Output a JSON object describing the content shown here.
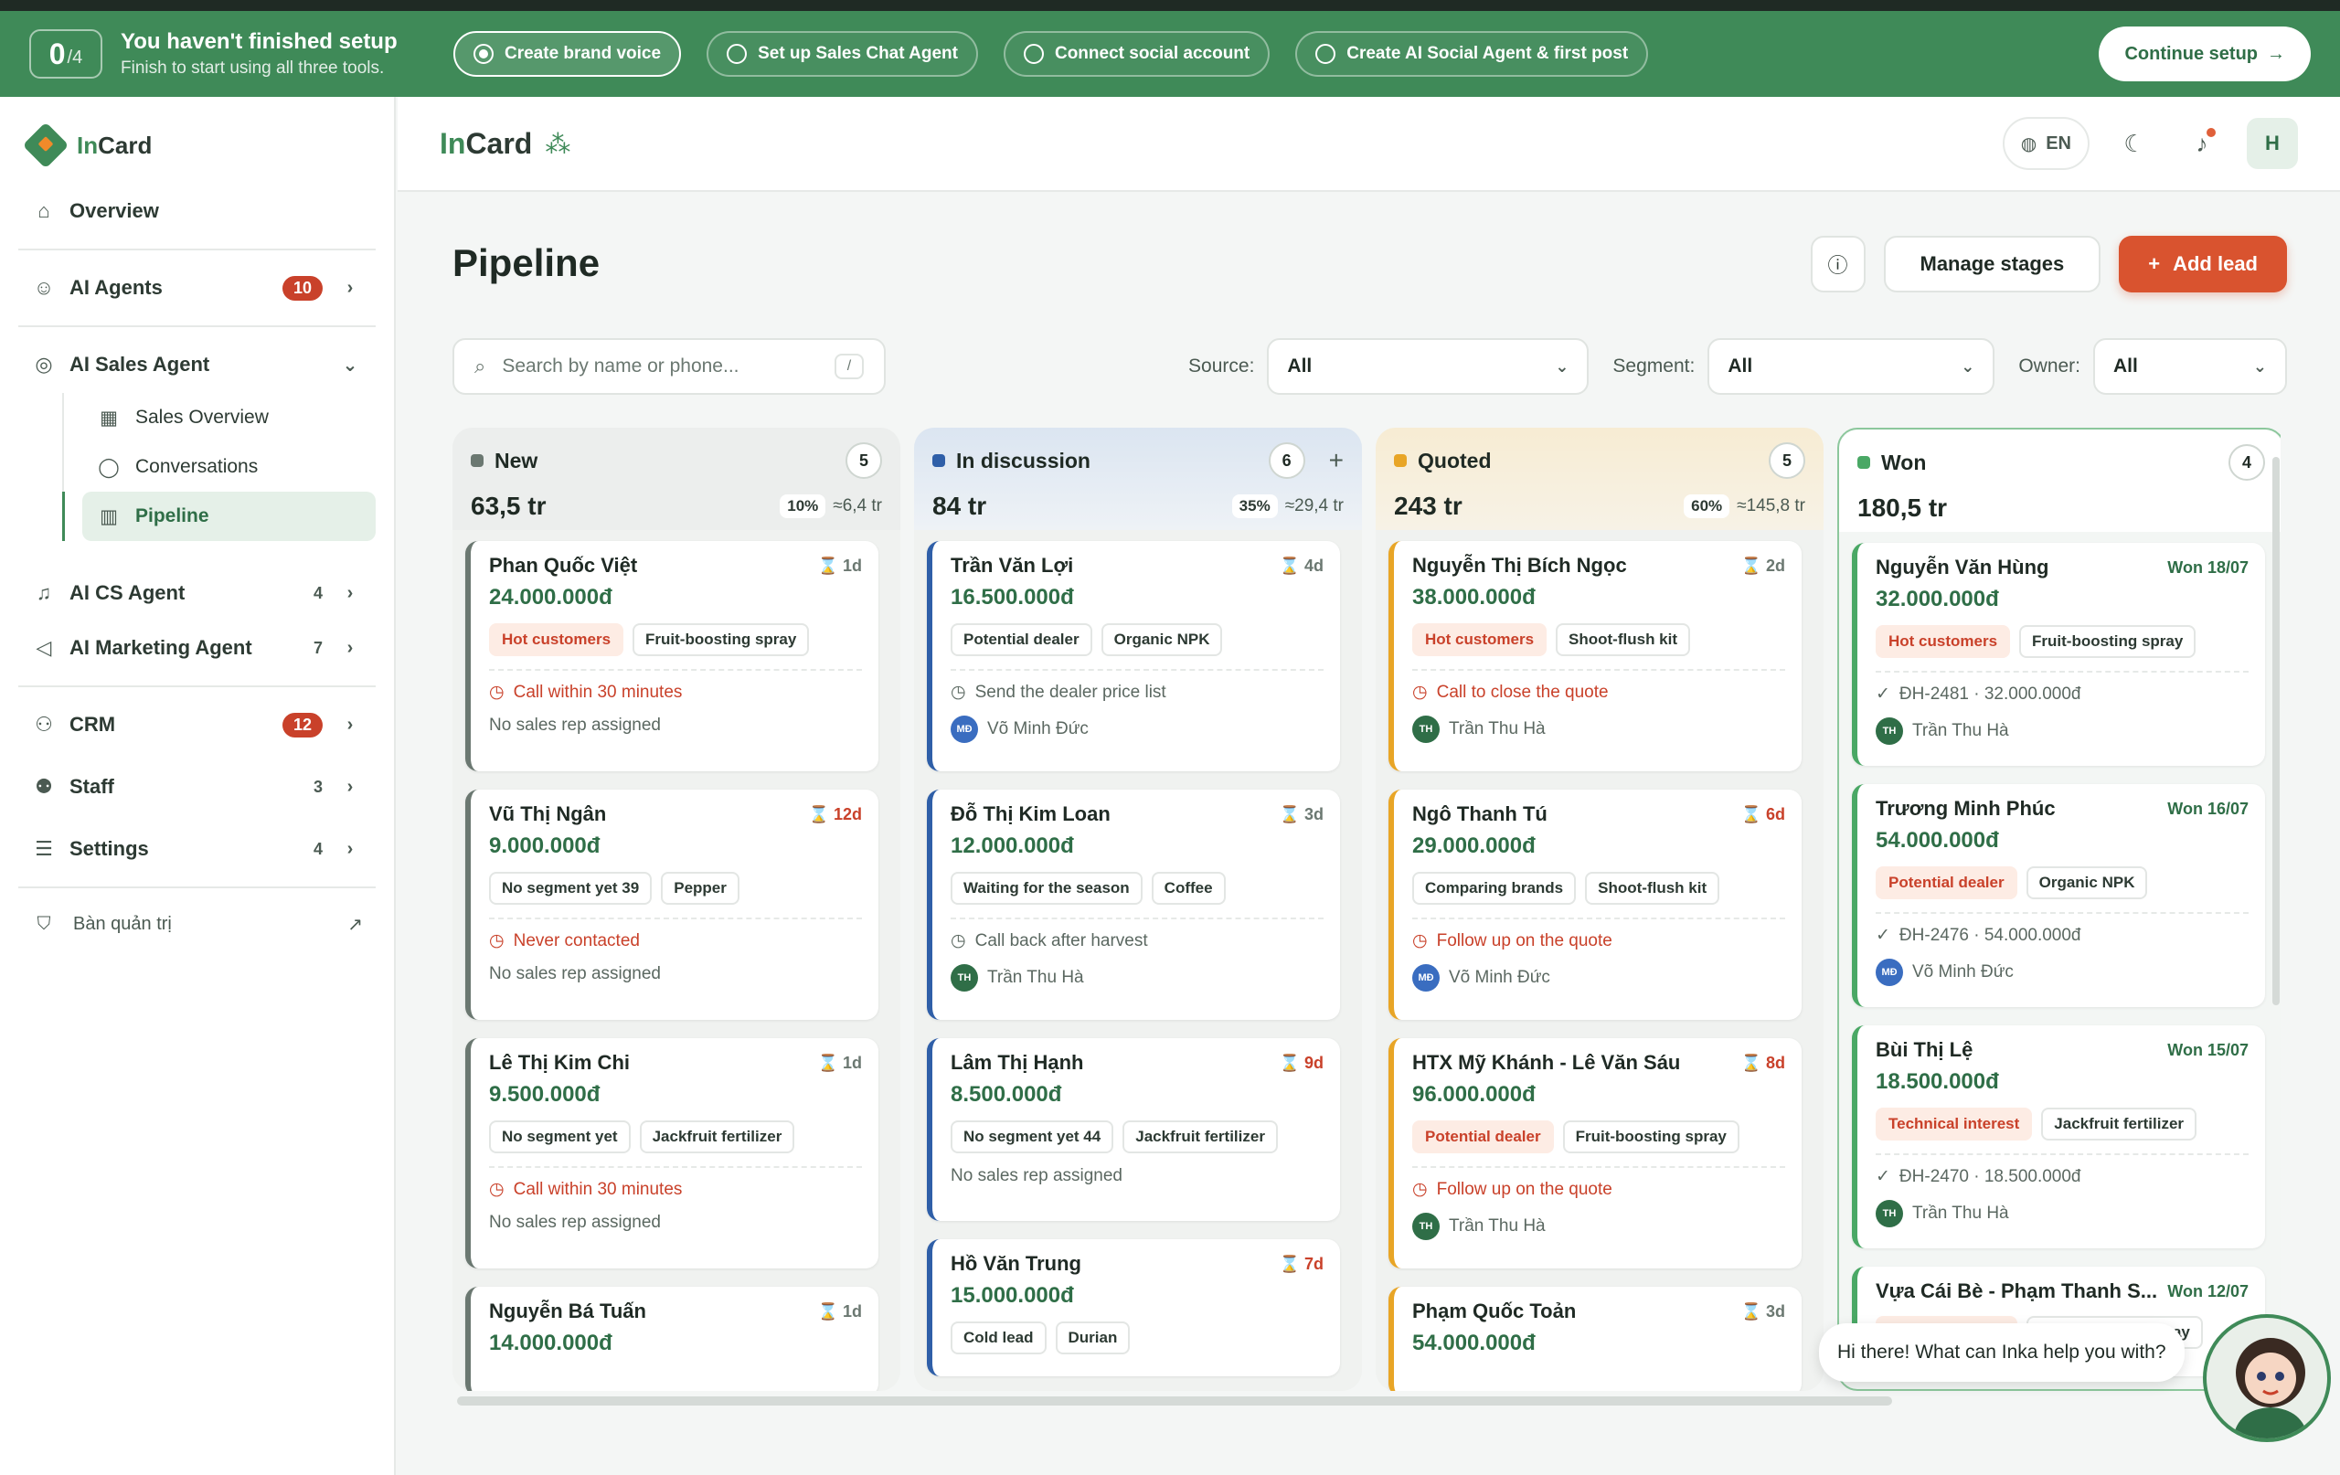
{
  "setup": {
    "progress_main": "0",
    "progress_total": "/4",
    "title": "You haven't finished setup",
    "subtitle": "Finish to start using all three tools.",
    "steps": [
      {
        "label": "Create brand voice"
      },
      {
        "label": "Set up Sales Chat Agent"
      },
      {
        "label": "Connect social account"
      },
      {
        "label": "Create AI Social Agent & first post"
      }
    ],
    "continue_label": "Continue setup",
    "continue_arrow": "→"
  },
  "sidebar": {
    "logo_prefix": "In",
    "logo_suffix": "Card",
    "overview": "Overview",
    "ai_agents": {
      "label": "AI Agents",
      "badge": "10"
    },
    "ai_sales_agent": {
      "label": "AI Sales Agent"
    },
    "sub_items": [
      {
        "label": "Sales Overview"
      },
      {
        "label": "Conversations"
      },
      {
        "label": "Pipeline"
      }
    ],
    "ai_cs_agent": {
      "label": "AI CS Agent",
      "count": "4"
    },
    "ai_marketing_agent": {
      "label": "AI Marketing Agent",
      "count": "7"
    },
    "crm": {
      "label": "CRM",
      "badge": "12"
    },
    "staff": {
      "label": "Staff",
      "count": "3"
    },
    "settings": {
      "label": "Settings",
      "count": "4"
    },
    "admin": "Bàn quản trị"
  },
  "header": {
    "brand_prefix": "In",
    "brand_suffix": "Card",
    "lang": "EN",
    "avatar": "H"
  },
  "page": {
    "title": "Pipeline",
    "manage_label": "Manage stages",
    "add_label": "Add lead",
    "add_icon": "+",
    "search_placeholder": "Search by name or phone...",
    "search_kbd": "/",
    "filters": [
      {
        "label": "Source:",
        "value": "All"
      },
      {
        "label": "Segment:",
        "value": "All"
      },
      {
        "label": "Owner:",
        "value": "All"
      }
    ]
  },
  "columns": [
    {
      "name": "New",
      "count": "5",
      "total": "63,5 tr",
      "pct": "10%",
      "est": "≈6,4 tr",
      "color": "#6b7871",
      "cards": [
        {
          "name": "Phan Quốc Việt",
          "age": "1d",
          "amount": "24.000.000đ",
          "tags": [
            "Hot customers",
            "Fruit-boosting spray"
          ],
          "task": "Call within 30 minutes",
          "owner": "No sales rep assigned"
        },
        {
          "name": "Vũ Thị Ngân",
          "age": "12d",
          "amount": "9.000.000đ",
          "tags": [
            "No segment yet 39",
            "Pepper"
          ],
          "task": "Never contacted",
          "owner": "No sales rep assigned"
        },
        {
          "name": "Lê Thị Kim Chi",
          "age": "1d",
          "amount": "9.500.000đ",
          "tags": [
            "No segment yet",
            "Jackfruit fertilizer"
          ],
          "task": "Call within 30 minutes",
          "owner": "No sales rep assigned"
        },
        {
          "name": "Nguyễn Bá Tuấn",
          "age": "1d",
          "amount": "14.000.000đ"
        }
      ]
    },
    {
      "name": "In discussion",
      "count": "6",
      "total": "84 tr",
      "pct": "35%",
      "est": "≈29,4 tr",
      "color": "#2f5fa8",
      "plus": "+",
      "cards": [
        {
          "name": "Trần Văn Lợi",
          "age": "4d",
          "amount": "16.500.000đ",
          "tags": [
            "Potential dealer",
            "Organic NPK"
          ],
          "task": "Send the dealer price list",
          "owner_initials": "MĐ",
          "owner": "Võ Minh Đức"
        },
        {
          "name": "Đỗ Thị Kim Loan",
          "age": "3d",
          "amount": "12.000.000đ",
          "tags": [
            "Waiting for the season",
            "Coffee"
          ],
          "task": "Call back after harvest",
          "owner_initials": "TH",
          "owner": "Trần Thu Hà"
        },
        {
          "name": "Lâm Thị Hạnh",
          "age": "9d",
          "amount": "8.500.000đ",
          "tags": [
            "No segment yet 44",
            "Jackfruit fertilizer"
          ],
          "owner": "No sales rep assigned"
        },
        {
          "name": "Hồ Văn Trung",
          "age": "7d",
          "amount": "15.000.000đ",
          "tags": [
            "Cold lead",
            "Durian"
          ]
        }
      ]
    },
    {
      "name": "Quoted",
      "count": "5",
      "total": "243 tr",
      "pct": "60%",
      "est": "≈145,8 tr",
      "color": "#e8a526",
      "cards": [
        {
          "name": "Nguyễn Thị Bích Ngọc",
          "age": "2d",
          "amount": "38.000.000đ",
          "tags": [
            "Hot customers",
            "Shoot-flush kit"
          ],
          "task": "Call to close the quote",
          "owner_initials": "TH",
          "owner": "Trần Thu Hà"
        },
        {
          "name": "Ngô Thanh Tú",
          "age": "6d",
          "amount": "29.000.000đ",
          "tags": [
            "Comparing brands",
            "Shoot-flush kit"
          ],
          "task": "Follow up on the quote",
          "owner_initials": "MĐ",
          "owner": "Võ Minh Đức"
        },
        {
          "name": "HTX Mỹ Khánh - Lê Văn Sáu",
          "age": "8d",
          "amount": "96.000.000đ",
          "tags": [
            "Potential dealer",
            "Fruit-boosting spray"
          ],
          "task": "Follow up on the quote",
          "owner_initials": "TH",
          "owner": "Trần Thu Hà"
        },
        {
          "name": "Phạm Quốc Toản",
          "age": "3d",
          "amount": "54.000.000đ"
        }
      ]
    },
    {
      "name": "Won",
      "count": "4",
      "total": "180,5 tr",
      "color": "#4aa865",
      "cards": [
        {
          "name": "Nguyễn Văn Hùng",
          "age": "Won 18/07",
          "amount": "32.000.000đ",
          "tags": [
            "Hot customers",
            "Fruit-boosting spray"
          ],
          "order": "ĐH-2481 · 32.000.000đ",
          "owner_initials": "TH",
          "owner": "Trần Thu Hà"
        },
        {
          "name": "Trương Minh Phúc",
          "age": "Won 16/07",
          "amount": "54.000.000đ",
          "tags": [
            "Potential dealer",
            "Organic NPK"
          ],
          "order": "ĐH-2476 · 54.000.000đ",
          "owner_initials": "MĐ",
          "owner": "Võ Minh Đức"
        },
        {
          "name": "Bùi Thị Lệ",
          "age": "Won 15/07",
          "amount": "18.500.000đ",
          "tags": [
            "Technical interest",
            "Jackfruit fertilizer"
          ],
          "order": "ĐH-2470 · 18.500.000đ",
          "owner_initials": "TH",
          "owner": "Trần Thu Hà"
        },
        {
          "name": "Vựa Cái Bè - Phạm Thanh S...",
          "age": "Won 12/07",
          "tags": [
            "Potential dealer",
            "Fruit-boosting spray"
          ]
        }
      ]
    }
  ],
  "chat": {
    "message": "Hi there! What can Inka help you with?"
  },
  "colors": {
    "brand": "#3f8a58",
    "accent": "#d9532f",
    "hot": "#c9412a"
  }
}
